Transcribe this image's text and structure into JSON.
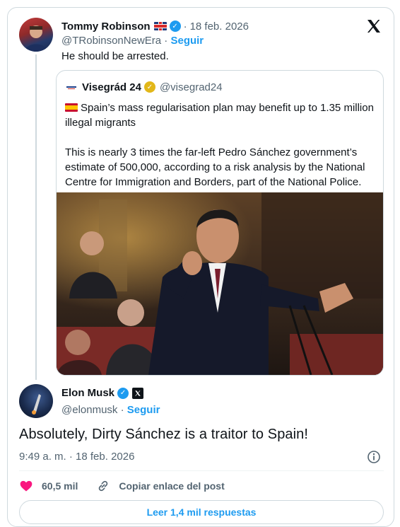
{
  "reply": {
    "name": "Tommy Robinson",
    "flag_icon": "uk-flag-icon",
    "date": "18 feb. 2026",
    "handle": "@TRobinsonNewEra",
    "separator": "·",
    "follow": "Seguir",
    "text": "He should be arrested."
  },
  "quoted": {
    "name": "Visegrád 24",
    "handle": "@visegrad24",
    "flag_icon": "spain-flag-icon",
    "line1": "Spain’s mass regularisation plan may benefit up to 1.35 million illegal migrants",
    "line2": "This is nearly 3 times the far-left Pedro Sánchez government’s estimate of 500,000, according to a risk analysis by the National Centre for Immigration and Borders, part of the National Police."
  },
  "tweet": {
    "name": "Elon Musk",
    "handle": "@elonmusk",
    "separator": "·",
    "follow": "Seguir",
    "text": "Absolutely, Dirty Sánchez is a traitor to Spain!",
    "timestamp": "9:49 a. m. · 18 feb. 2026",
    "likes": "60,5 mil",
    "copy_link": "Copiar enlace del post",
    "read_replies": "Leer 1,4 mil respuestas"
  },
  "colors": {
    "accent": "#1d9bf0",
    "like": "#f91880",
    "text": "#0f1419",
    "muted": "#536471",
    "border": "#cfd9de"
  }
}
